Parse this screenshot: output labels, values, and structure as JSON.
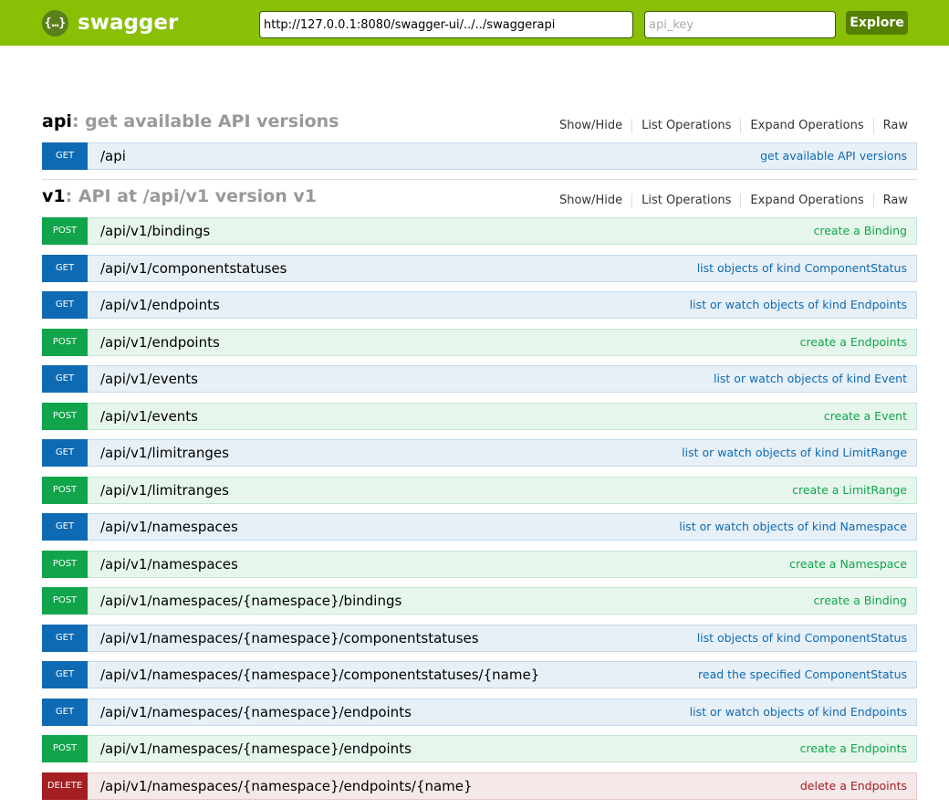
{
  "header": {
    "logo_glyph": "{…}",
    "logo_text": "swagger",
    "url_value": "http://127.0.0.1:8080/swagger-ui/../../swaggerapi",
    "api_key_placeholder": "api_key",
    "explore_label": "Explore"
  },
  "resources": [
    {
      "name": "api",
      "description": ": get available API versions",
      "links": [
        "Show/Hide",
        "List Operations",
        "Expand Operations",
        "Raw"
      ],
      "operations": [
        {
          "method": "GET",
          "path": "/api",
          "summary": "get available API versions"
        }
      ]
    },
    {
      "name": "v1",
      "description": ": API at /api/v1 version v1",
      "links": [
        "Show/Hide",
        "List Operations",
        "Expand Operations",
        "Raw"
      ],
      "operations": [
        {
          "method": "POST",
          "path": "/api/v1/bindings",
          "summary": "create a Binding"
        },
        {
          "method": "GET",
          "path": "/api/v1/componentstatuses",
          "summary": "list objects of kind ComponentStatus"
        },
        {
          "method": "GET",
          "path": "/api/v1/endpoints",
          "summary": "list or watch objects of kind Endpoints"
        },
        {
          "method": "POST",
          "path": "/api/v1/endpoints",
          "summary": "create a Endpoints"
        },
        {
          "method": "GET",
          "path": "/api/v1/events",
          "summary": "list or watch objects of kind Event"
        },
        {
          "method": "POST",
          "path": "/api/v1/events",
          "summary": "create a Event"
        },
        {
          "method": "GET",
          "path": "/api/v1/limitranges",
          "summary": "list or watch objects of kind LimitRange"
        },
        {
          "method": "POST",
          "path": "/api/v1/limitranges",
          "summary": "create a LimitRange"
        },
        {
          "method": "GET",
          "path": "/api/v1/namespaces",
          "summary": "list or watch objects of kind Namespace"
        },
        {
          "method": "POST",
          "path": "/api/v1/namespaces",
          "summary": "create a Namespace"
        },
        {
          "method": "POST",
          "path": "/api/v1/namespaces/{namespace}/bindings",
          "summary": "create a Binding"
        },
        {
          "method": "GET",
          "path": "/api/v1/namespaces/{namespace}/componentstatuses",
          "summary": "list objects of kind ComponentStatus"
        },
        {
          "method": "GET",
          "path": "/api/v1/namespaces/{namespace}/componentstatuses/{name}",
          "summary": "read the specified ComponentStatus"
        },
        {
          "method": "GET",
          "path": "/api/v1/namespaces/{namespace}/endpoints",
          "summary": "list or watch objects of kind Endpoints"
        },
        {
          "method": "POST",
          "path": "/api/v1/namespaces/{namespace}/endpoints",
          "summary": "create a Endpoints"
        },
        {
          "method": "DELETE",
          "path": "/api/v1/namespaces/{namespace}/endpoints/{name}",
          "summary": "delete a Endpoints"
        }
      ]
    }
  ],
  "colors": {
    "header_bg": "#89bf04",
    "get": "#0f6ab4",
    "post": "#10a54a",
    "delete": "#a41e22"
  }
}
